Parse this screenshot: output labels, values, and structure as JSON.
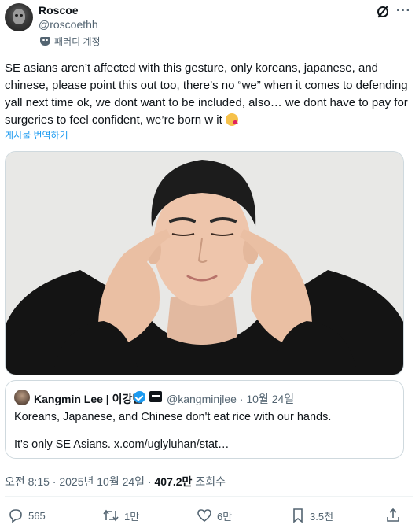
{
  "author": {
    "name": "Roscoe",
    "handle": "@roscoethh",
    "parody_label": "패러디 계정"
  },
  "tweet": {
    "text": "SE asians aren’t affected with this gesture, only koreans, japanese, and chinese, please point this out too, there’s no “we” when it comes to defending yall next time ok, we dont want to be included, also… we dont have to pay for surgeries to feel confident, we’re born w it",
    "emoji": "kissing-face-with-heart",
    "translate_label": "게시물 번역하기"
  },
  "quote": {
    "name": "Kangmin Lee | 이강민",
    "handle": "@kangminjlee · 10월 24일",
    "line1": "Koreans, Japanese, and Chinese don't eat rice with our hands.",
    "line2": "It's only SE Asians. x.com/uglyluhan/stat…"
  },
  "meta": {
    "timestamp": "오전 8:15 · 2025년 10월 24일 · ",
    "views": "407.2만",
    "views_label": " 조회수"
  },
  "actions": {
    "replies": "565",
    "reposts": "1만",
    "likes": "6만",
    "bookmarks": "3.5천"
  },
  "colors": {
    "link": "#1d9bf0",
    "secondary_text": "#536471",
    "primary_text": "#0f1419"
  }
}
